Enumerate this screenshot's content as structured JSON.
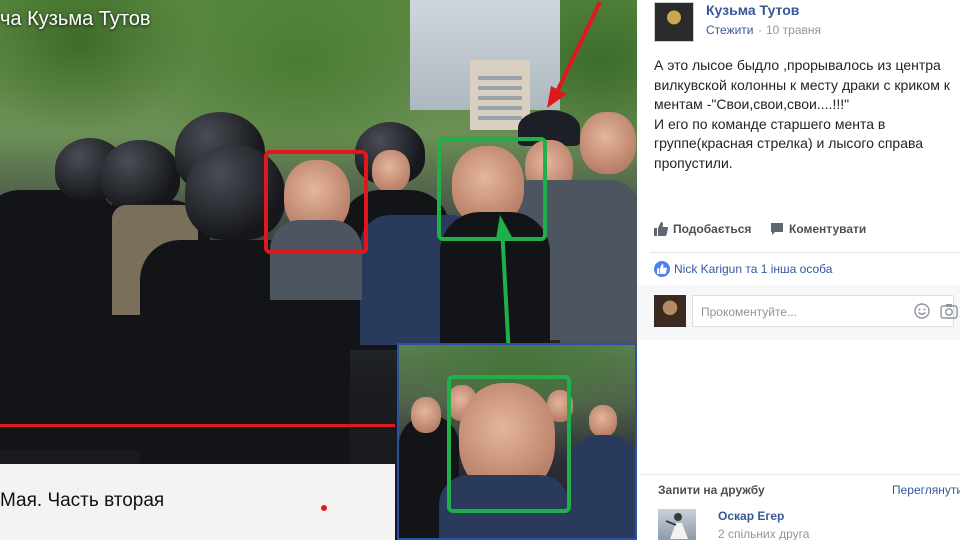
{
  "video": {
    "title": "ча Кузьма Тутов",
    "caption": "Мая. Часть вторая"
  },
  "post": {
    "author": "Кузьма Тутов",
    "follow_label": "Стежити",
    "dot": "·",
    "date": "10 травня",
    "text_lines": [
      "А это лысое быдло ,прорывалось из центра",
      "вилкувской колонны к месту драки с криком к",
      "ментам -\"Свои,свои,свои....!!!\"",
      "И его по команде старшего мента в",
      "группе(красная стрелка) и лысого справа",
      "пропустили."
    ],
    "like_label": "Подобається",
    "comment_label": "Коментувати",
    "likes_text": "Nick Karigun та 1 інша особа",
    "comment_placeholder": "Прокоментуйте..."
  },
  "requests": {
    "title": "Запити на дружбу",
    "see_all": "Переглянути",
    "name": "Оскар Егер",
    "mutual": "2 спільних друга"
  },
  "colors": {
    "red_marker": "#e0181e",
    "green_marker": "#1fb04a",
    "blue_inset": "#2d4fa6",
    "link_blue": "#365899"
  }
}
